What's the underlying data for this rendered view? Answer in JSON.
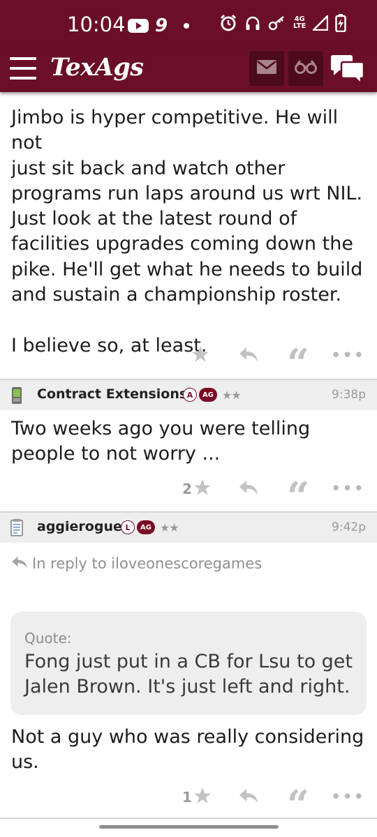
{
  "status_bar": {
    "time": "10:04",
    "notification_count": "9",
    "network_label_top": "4G",
    "network_label_bottom": "LTE",
    "icons": [
      "youtube-icon",
      "dot-icon",
      "alarm-icon",
      "headphones-icon",
      "key-icon",
      "signal-icon",
      "battery-icon"
    ]
  },
  "app_header": {
    "logo": "TexAgs",
    "icons": [
      "menu-icon",
      "mail-icon",
      "binoculars-icon",
      "chat-icon"
    ],
    "brand_color": "#6b0f28"
  },
  "posts": [
    {
      "body_lines": [
        "Jimbo is hyper competitive. He will not",
        "just sit back and watch other",
        "programs run laps around us wrt NIL.",
        "Just look at the latest round of",
        "facilities upgrades coming down the",
        "pike. He'll get what he needs to build",
        "and sustain a championship roster.",
        "",
        "I believe so, at least."
      ],
      "likes": ""
    },
    {
      "username": "Contract Extensions",
      "user_icon": "phone-icon",
      "badge_letter": "A",
      "badge_ag": "AG",
      "stars": "★★",
      "time": "9:38p",
      "body_lines": [
        "Two weeks ago you were telling",
        "people to not worry ..."
      ],
      "likes": "2"
    },
    {
      "username": "aggierogue",
      "user_icon": "notepad-icon",
      "badge_letter": "L",
      "badge_ag": "AG",
      "stars": "★★",
      "time": "9:42p",
      "reply_to": "In reply to iloveonescoregames",
      "quote_label": "Quote:",
      "quote_lines": [
        "Fong just put in a CB for Lsu to get",
        "Jalen Brown. It's just left and right."
      ],
      "body_lines": [
        "Not a guy who was really considering",
        "us."
      ],
      "likes": "1"
    }
  ],
  "actions": {
    "star_glyph": "★",
    "quote_glyph": "“",
    "more_glyph": "•••"
  }
}
